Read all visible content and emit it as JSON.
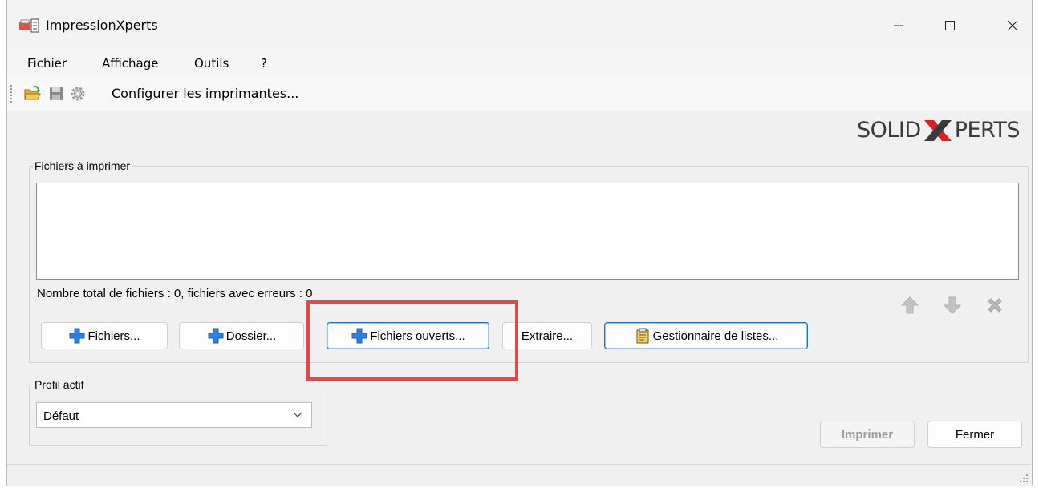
{
  "window": {
    "title": "ImpressionXperts"
  },
  "menu": {
    "items": [
      "Fichier",
      "Affichage",
      "Outils",
      "?"
    ]
  },
  "toolbar": {
    "configure_label": "Configurer les imprimantes..."
  },
  "logo": {
    "left": "SOLID",
    "right": "PERTS",
    "accent_color": "#e02020"
  },
  "files_group": {
    "legend": "Fichiers à imprimer",
    "count_text": "Nombre total de fichiers : 0, fichiers avec erreurs : 0",
    "buttons": {
      "files": "Fichiers...",
      "folder": "Dossier...",
      "open_files": "Fichiers ouverts...",
      "extract": "Extraire...",
      "list_manager": "Gestionnaire de listes..."
    }
  },
  "profile_group": {
    "legend": "Profil actif",
    "selected": "Défaut"
  },
  "actions": {
    "print": "Imprimer",
    "close": "Fermer"
  },
  "icons": [
    "app-icon",
    "open-folder-icon",
    "save-icon",
    "gear-icon",
    "plus-icon",
    "list-manager-icon",
    "up-arrow-icon",
    "down-arrow-icon",
    "delete-icon",
    "chevron-down-icon",
    "resize-grip-icon"
  ],
  "colors": {
    "highlight": "#e44848",
    "plus_blue": "#2f7fe0",
    "selection_border": "#1a6fc9"
  }
}
